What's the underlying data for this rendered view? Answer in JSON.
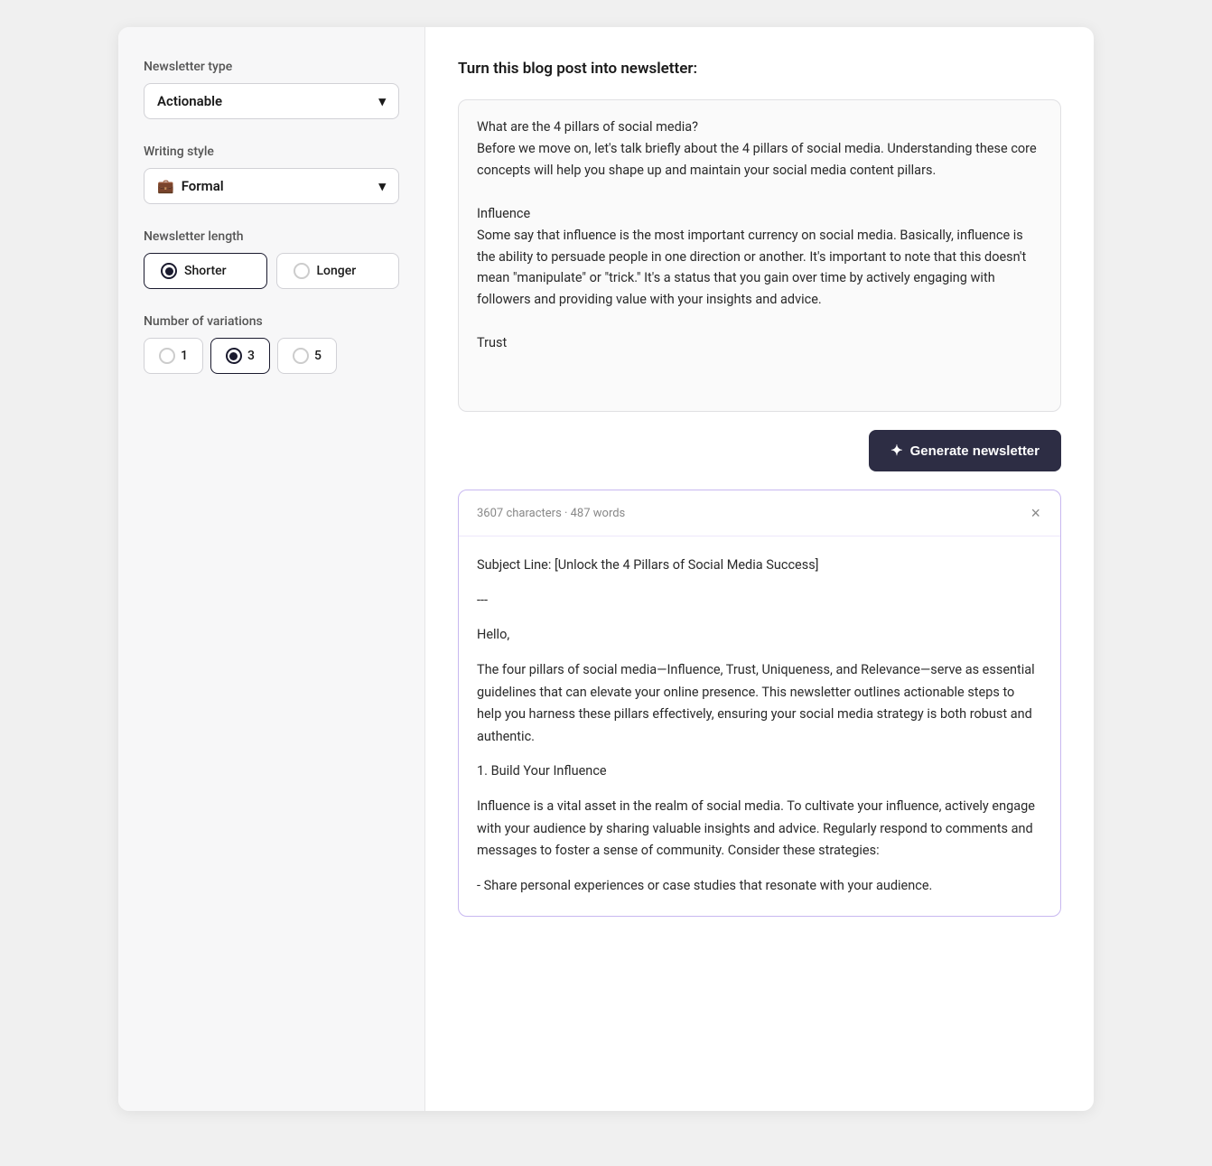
{
  "sidebar": {
    "newsletter_type_label": "Newsletter type",
    "newsletter_type_value": "Actionable",
    "newsletter_type_chevron": "▾",
    "writing_style_label": "Writing style",
    "writing_style_icon": "💼",
    "writing_style_value": "Formal",
    "writing_style_chevron": "▾",
    "newsletter_length_label": "Newsletter length",
    "length_options": [
      {
        "label": "Shorter",
        "value": "shorter",
        "selected": true
      },
      {
        "label": "Longer",
        "value": "longer",
        "selected": false
      }
    ],
    "variations_label": "Number of variations",
    "variation_options": [
      {
        "label": "1",
        "value": "1",
        "selected": false
      },
      {
        "label": "3",
        "value": "3",
        "selected": true
      },
      {
        "label": "5",
        "value": "5",
        "selected": false
      }
    ]
  },
  "main": {
    "title": "Turn this blog post into newsletter:",
    "blog_content": "What are the 4 pillars of social media?\nBefore we move on, let's talk briefly about the 4 pillars of social media. Understanding these core concepts will help you shape up and maintain your social media content pillars.\n\nInfluence\nSome say that influence is the most important currency on social media. Basically, influence is the ability to persuade people in one direction or another. It's important to note that this doesn't mean \"manipulate\" or \"trick.\" It's a status that you gain over time by actively engaging with followers and providing value with your insights and advice.\n\nTrust",
    "generate_button_label": "Generate newsletter",
    "generate_sparkle": "✦",
    "result": {
      "stats": "3607 characters · 487 words",
      "close_icon": "×",
      "subject_line": "Subject Line: [Unlock the 4 Pillars of Social Media Success]",
      "separator": "---",
      "greeting": "Hello,",
      "paragraph1": "The four pillars of social media—Influence, Trust, Uniqueness, and Relevance—serve as essential guidelines that can elevate your online presence. This newsletter outlines actionable steps to help you harness these pillars effectively, ensuring your social media strategy is both robust and authentic.",
      "section1_title": "1. Build Your Influence",
      "section1_body": "Influence is a vital asset in the realm of social media. To cultivate your influence, actively engage with your audience by sharing valuable insights and advice. Regularly respond to comments and messages to foster a sense of community. Consider these strategies:",
      "section1_bullet": "- Share personal experiences or case studies that resonate with your audience."
    }
  }
}
